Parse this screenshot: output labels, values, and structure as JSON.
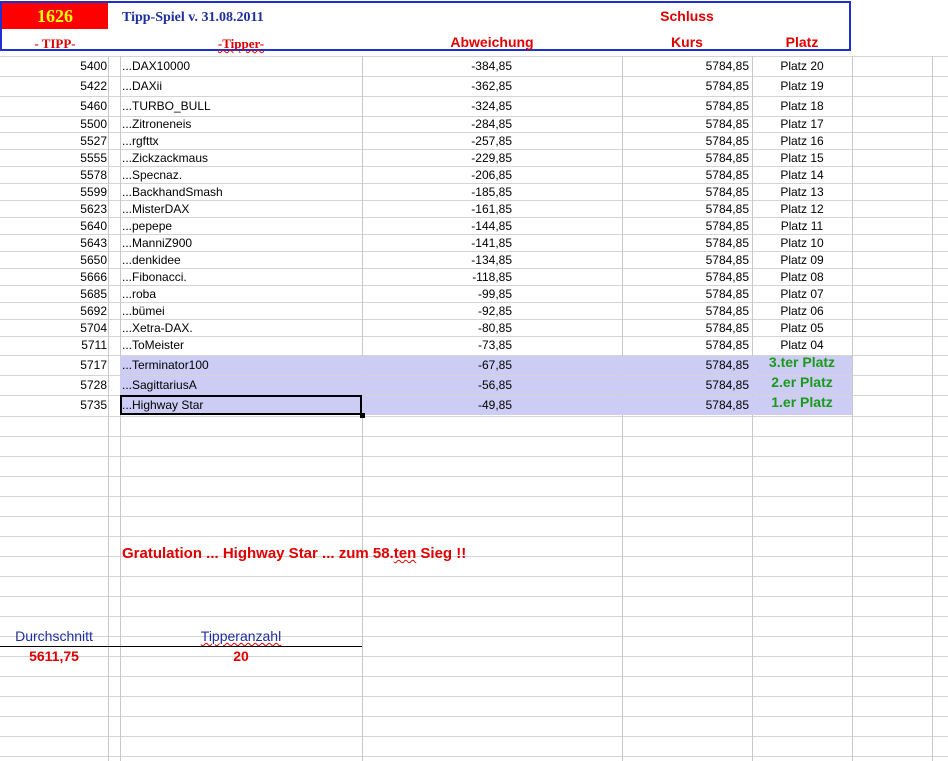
{
  "header": {
    "count": "1626",
    "title": "Tipp-Spiel v. 31.08.2011",
    "schluss": "Schluss",
    "col_tipp": "- TIPP-",
    "col_tipper": "-Tipper-",
    "col_abweichung": "Abweichung",
    "col_kurs": "Kurs",
    "col_platz": "Platz"
  },
  "colors": {
    "header_red": "#e00000",
    "header_blue": "#1f2fd0",
    "highlight": "#ccccf5",
    "winner_green": "#1a9a1a"
  },
  "rows": [
    {
      "tipp": "5400",
      "tipper": "...DAX10000",
      "abw": "-384,85",
      "kurs": "5784,85",
      "platz": "Platz 20"
    },
    {
      "tipp": "5422",
      "tipper": "...DAXii",
      "abw": "-362,85",
      "kurs": "5784,85",
      "platz": "Platz 19"
    },
    {
      "tipp": "5460",
      "tipper": "...TURBO_BULL",
      "abw": "-324,85",
      "kurs": "5784,85",
      "platz": "Platz 18"
    },
    {
      "tipp": "5500",
      "tipper": "...Zitroneneis",
      "abw": "-284,85",
      "kurs": "5784,85",
      "platz": "Platz 17"
    },
    {
      "tipp": "5527",
      "tipper": "...rgfttx",
      "abw": "-257,85",
      "kurs": "5784,85",
      "platz": "Platz 16"
    },
    {
      "tipp": "5555",
      "tipper": "...Zickzackmaus",
      "abw": "-229,85",
      "kurs": "5784,85",
      "platz": "Platz 15"
    },
    {
      "tipp": "5578",
      "tipper": "...Specnaz.",
      "abw": "-206,85",
      "kurs": "5784,85",
      "platz": "Platz 14"
    },
    {
      "tipp": "5599",
      "tipper": "...BackhandSmash",
      "abw": "-185,85",
      "kurs": "5784,85",
      "platz": "Platz 13"
    },
    {
      "tipp": "5623",
      "tipper": "...MisterDAX",
      "abw": "-161,85",
      "kurs": "5784,85",
      "platz": "Platz 12"
    },
    {
      "tipp": "5640",
      "tipper": "...pepepe",
      "abw": "-144,85",
      "kurs": "5784,85",
      "platz": "Platz 11"
    },
    {
      "tipp": "5643",
      "tipper": "...ManniZ900",
      "abw": "-141,85",
      "kurs": "5784,85",
      "platz": "Platz 10"
    },
    {
      "tipp": "5650",
      "tipper": "...denkidee",
      "abw": "-134,85",
      "kurs": "5784,85",
      "platz": "Platz 09"
    },
    {
      "tipp": "5666",
      "tipper": "...Fibonacci.",
      "abw": "-118,85",
      "kurs": "5784,85",
      "platz": "Platz 08"
    },
    {
      "tipp": "5685",
      "tipper": "...roba",
      "abw": "-99,85",
      "kurs": "5784,85",
      "platz": "Platz 07"
    },
    {
      "tipp": "5692",
      "tipper": "...bümei",
      "abw": "-92,85",
      "kurs": "5784,85",
      "platz": "Platz 06"
    },
    {
      "tipp": "5704",
      "tipper": "...Xetra-DAX.",
      "abw": "-80,85",
      "kurs": "5784,85",
      "platz": "Platz 05"
    },
    {
      "tipp": "5711",
      "tipper": "...ToMeister",
      "abw": "-73,85",
      "kurs": "5784,85",
      "platz": "Platz 04"
    }
  ],
  "winners": [
    {
      "tipp": "5717",
      "tipper": "...Terminator100",
      "abw": "-67,85",
      "kurs": "5784,85",
      "platz": "3.ter Platz"
    },
    {
      "tipp": "5728",
      "tipper": "...SagittariusA",
      "abw": "-56,85",
      "kurs": "5784,85",
      "platz": "2.er Platz"
    },
    {
      "tipp": "5735",
      "tipper": "...Highway Star",
      "abw": "-49,85",
      "kurs": "5784,85",
      "platz": "1.er Platz"
    }
  ],
  "message": {
    "part1": "Gratulation ...  Highway Star  ...  zum  58.",
    "part2": "ten",
    "part3": " Sieg !!"
  },
  "summary": {
    "avg_label": "Durchschnitt",
    "avg_value": "5611,75",
    "count_label": "Tipperanzahl",
    "count_value": "20"
  }
}
